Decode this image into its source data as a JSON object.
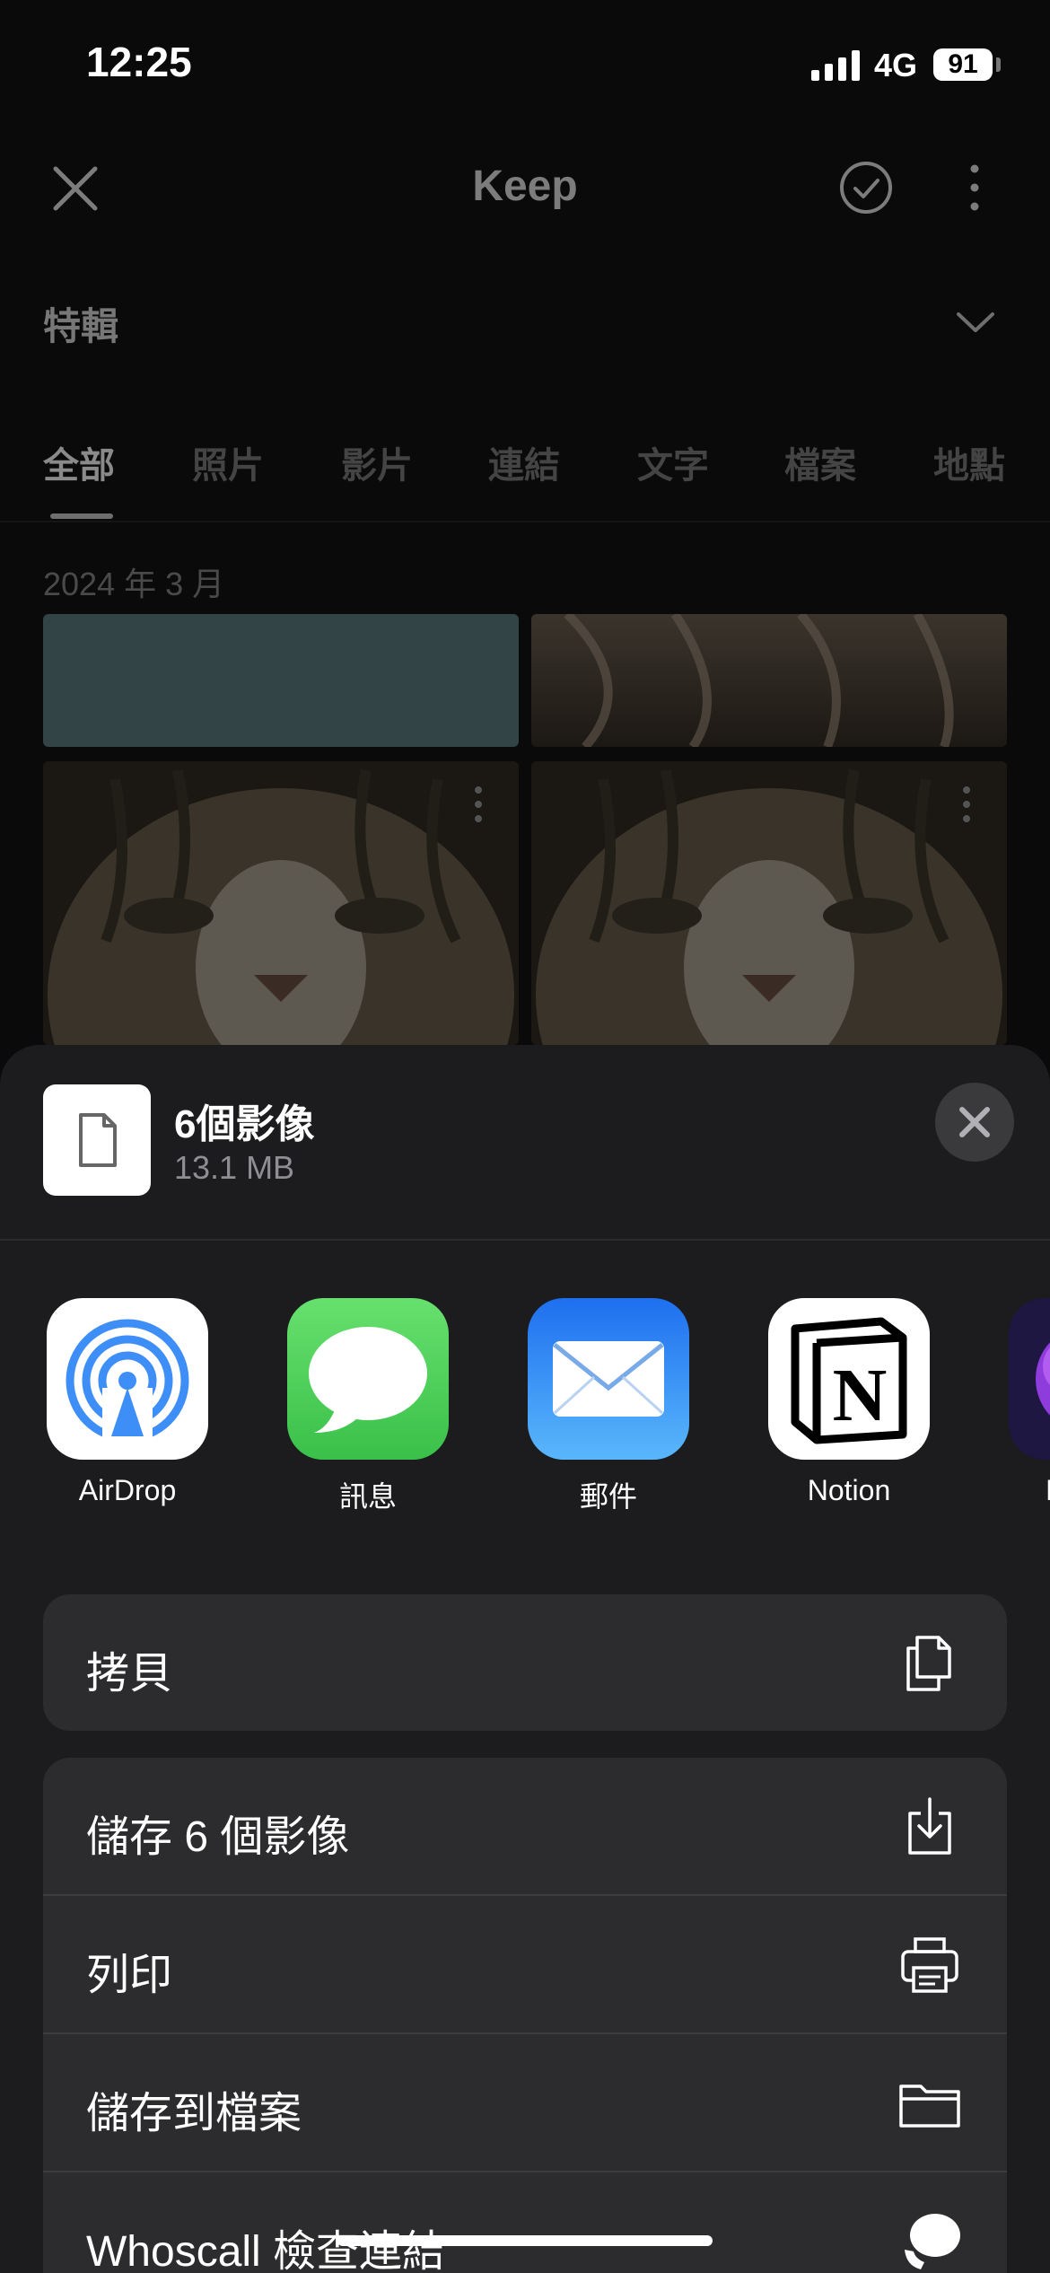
{
  "status_bar": {
    "time": "12:25",
    "network": "4G",
    "battery": "91"
  },
  "app_bar": {
    "title": "Keep",
    "close_icon": "close-icon",
    "select_icon": "check-circle-icon",
    "more_icon": "more-vert-icon"
  },
  "album": {
    "label": "特輯",
    "icon": "chevron-down-icon"
  },
  "tabs": [
    {
      "label": "全部",
      "active": true
    },
    {
      "label": "照片"
    },
    {
      "label": "影片"
    },
    {
      "label": "連結"
    },
    {
      "label": "文字"
    },
    {
      "label": "檔案"
    },
    {
      "label": "地點"
    }
  ],
  "grid": {
    "date_header": "2024 年 3 月"
  },
  "share_sheet": {
    "title": "6個影像",
    "subtitle": "13.1 MB",
    "apps": [
      {
        "label": "AirDrop",
        "icon": "airdrop-icon"
      },
      {
        "label": "訊息",
        "icon": "messages-icon"
      },
      {
        "label": "郵件",
        "icon": "mail-icon"
      },
      {
        "label": "Notion",
        "icon": "notion-icon"
      },
      {
        "label": "Firefox",
        "icon": "firefox-icon"
      }
    ],
    "actions_primary": [
      {
        "label": "拷貝",
        "icon": "copy-icon"
      }
    ],
    "actions": [
      {
        "label": "儲存 6 個影像",
        "icon": "save-download-icon"
      },
      {
        "label": "列印",
        "icon": "print-icon"
      },
      {
        "label": "儲存到檔案",
        "icon": "folder-icon"
      },
      {
        "label": "Whoscall 檢查連結",
        "icon": "whoscall-icon"
      }
    ]
  },
  "colors": {
    "sheet_bg": "#1c1c1e",
    "row_bg": "#2c2c2e",
    "messages_green": "#4cd964",
    "mail_blue": "#2f8cf4",
    "airdrop_blue": "#3e8ef7"
  }
}
